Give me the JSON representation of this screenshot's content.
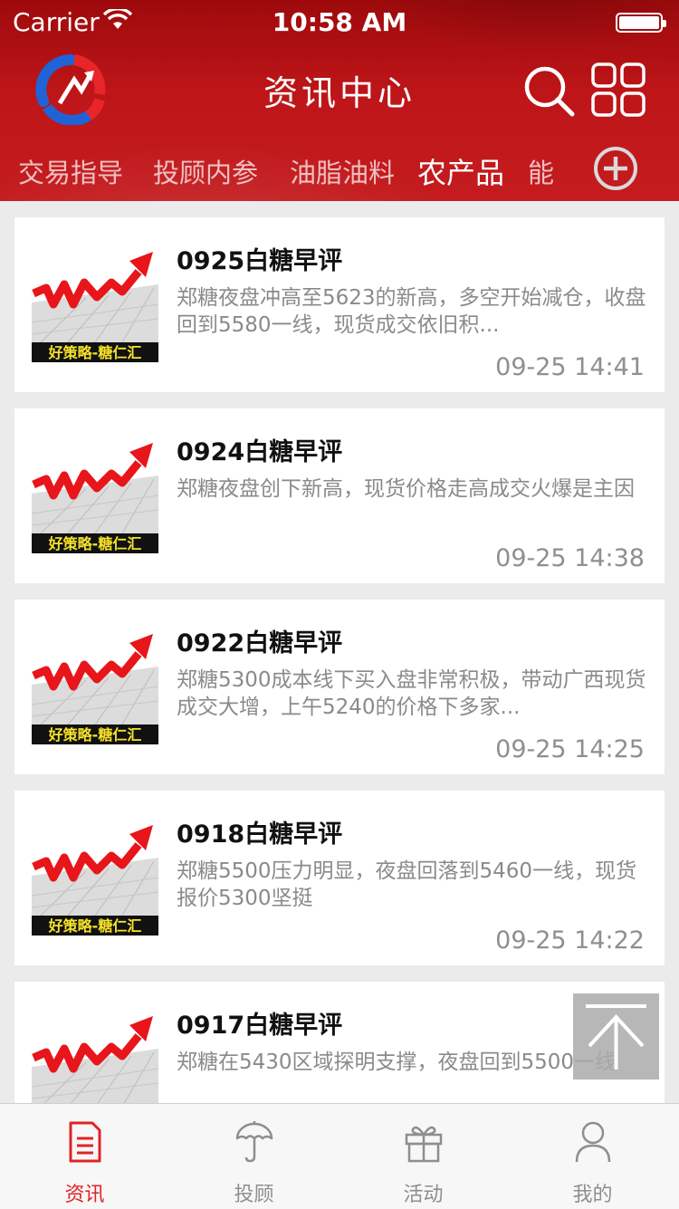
{
  "status_bar": {
    "carrier": "Carrier",
    "time": "10:58 AM"
  },
  "header": {
    "title": "资讯中心",
    "logo_icon": "app-logo-icon",
    "search_icon": "search-icon",
    "menu_icon": "grid-menu-icon"
  },
  "category_tabs": {
    "items": [
      {
        "label": "交易指导",
        "active": false
      },
      {
        "label": "投顾内参",
        "active": false
      },
      {
        "label": "油脂油料",
        "active": false
      },
      {
        "label": "农产品",
        "active": true
      },
      {
        "label": "能",
        "active": false
      }
    ],
    "add_icon": "plus-circle-icon"
  },
  "thumbnail_caption": "好策略-糖仁汇",
  "articles": [
    {
      "title": "0925白糖早评",
      "summary": "郑糖夜盘冲高至5623的新高，多空开始减仓，收盘回到5580一线，现货成交依旧积...",
      "time": "09-25 14:41"
    },
    {
      "title": "0924白糖早评",
      "summary": "郑糖夜盘创下新高，现货价格走高成交火爆是主因",
      "time": "09-25 14:38"
    },
    {
      "title": "0922白糖早评",
      "summary": "郑糖5300成本线下买入盘非常积极，带动广西现货成交大增，上午5240的价格下多家...",
      "time": "09-25 14:25"
    },
    {
      "title": "0918白糖早评",
      "summary": "郑糖5500压力明显，夜盘回落到5460一线，现货报价5300坚挺",
      "time": "09-25 14:22"
    },
    {
      "title": "0917白糖早评",
      "summary": "郑糖在5430区域探明支撑，夜盘回到5500一线",
      "time": ""
    }
  ],
  "back_to_top_icon": "arrow-to-top-icon",
  "tab_bar": [
    {
      "label": "资讯",
      "icon": "document-icon",
      "active": true
    },
    {
      "label": "投顾",
      "icon": "umbrella-icon",
      "active": false
    },
    {
      "label": "活动",
      "icon": "gift-icon",
      "active": false
    },
    {
      "label": "我的",
      "icon": "person-icon",
      "active": false
    }
  ],
  "colors": {
    "header_red": "#bd1518",
    "active_red": "#e02326",
    "background": "#ebebeb"
  }
}
